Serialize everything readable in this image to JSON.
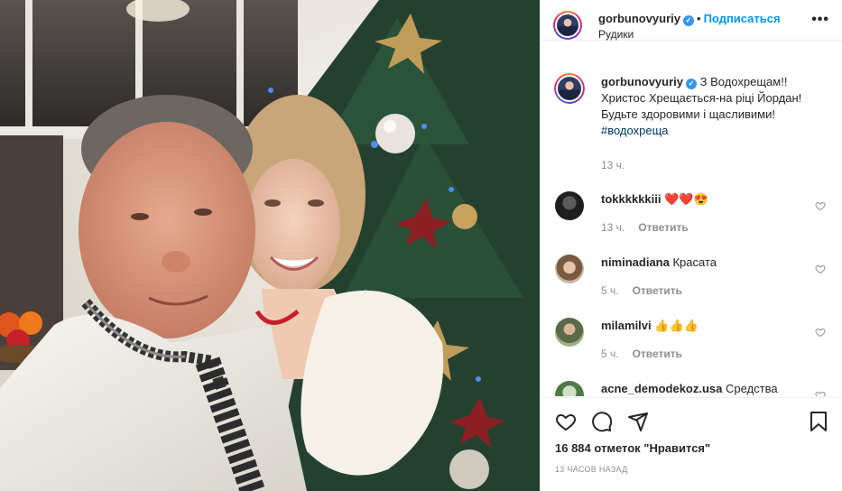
{
  "post": {
    "username": "gorbunovyuriy",
    "verified_mark": "✓",
    "separator": "•",
    "follow_label": "Подписаться",
    "location": "Рудики",
    "more_glyph": "•••"
  },
  "caption": {
    "username": "gorbunovyuriy",
    "line1": "З Водохрещам!!",
    "line2": "Христос Хрещається-на ріці Йордан!",
    "line3": "Будьте здоровими і щасливими!",
    "hashtag": "#водохреща",
    "time": "13 ч."
  },
  "comments": [
    {
      "username": "tokkkkkkiii",
      "text": "❤️❤️😍",
      "time": "13 ч.",
      "reply_label": "Ответить"
    },
    {
      "username": "niminadiana",
      "text": "Красата",
      "time": "5 ч.",
      "reply_label": "Ответить"
    },
    {
      "username": "milamilvi",
      "text": "👍👍👍",
      "time": "5 ч.",
      "reply_label": "Ответить"
    },
    {
      "username": "acne_demodekoz.usa",
      "text": "Средства",
      "time": "",
      "reply_label": ""
    }
  ],
  "footer": {
    "likes": "16 884 отметок \"Нравится\"",
    "timestamp": "13 часов назад"
  },
  "icons": {
    "like": "heart-icon",
    "comment": "comment-icon",
    "share": "share-icon",
    "save": "bookmark-icon",
    "more": "more-icon"
  },
  "colors": {
    "accent": "#0095f6",
    "verified": "#3897f0",
    "muted": "#8e8e8e",
    "text": "#262626"
  }
}
